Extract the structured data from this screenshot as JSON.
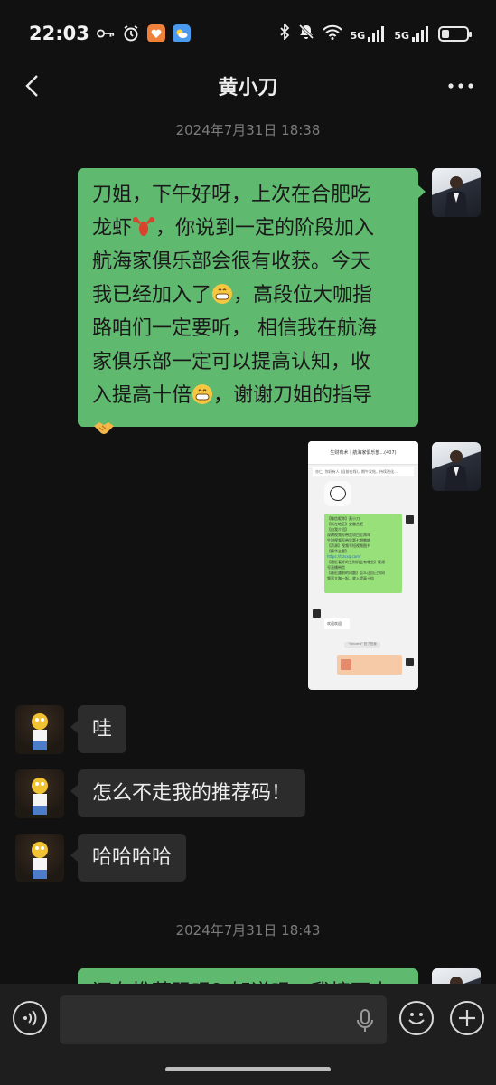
{
  "status_bar": {
    "time": "22:03",
    "network_1": "5G",
    "network_2": "5G",
    "icons": [
      "key-icon",
      "alarm-icon",
      "app-heart-icon",
      "app-weather-icon",
      "bluetooth-icon",
      "mute-icon",
      "wifi-icon",
      "signal-icon",
      "battery-icon"
    ],
    "battery_level": 0.3
  },
  "nav": {
    "title": "黄小刀",
    "back_icon": "chevron-left-icon",
    "more_icon": "more-dots-icon"
  },
  "messages": {
    "ts1": "2024年7月31日 18:38",
    "msg1": {
      "line1": "刀姐，下午好呀，上次在合肥吃",
      "line2a": "龙虾",
      "line2b": "，你说到一定的阶段加入",
      "line3": "航海家俱乐部会很有收获。今天",
      "line4a": "我已经加入了",
      "line4b": "，高段位大咖指",
      "line5": "路咱们一定要听， 相信我在航海",
      "line6": "家俱乐部一定可以提高认知，收",
      "line7a": "入提高十倍",
      "line7b": "，谢谢刀姐的指导"
    },
    "image": {
      "header": "生财有术｜航海家俱乐部...(407)",
      "notice": "亦仁: 你好有人 (当前在线)，期午发帖，持续进化...",
      "green_lines": [
        "【微信昵称】黄小刀",
        "【所在地区】安徽合肥",
        "【自我介绍】",
        "深耕视频号带货项目近两年",
        "生财视频号带货第七期教练",
        "【资源】视频号短视频图书",
        "【精华主题】",
        "https://t.zsxq.com/",
        "【最近看好的生财机会有哪些】视频",
        "号直播带货",
        "【最近遇到的问题】怎么让自己到同",
        "频率大咖一起，收入提高十倍"
      ],
      "reply": "欢迎欢迎",
      "system": "\"Vincent\" 拍了拍我"
    },
    "ts2": "2024年7月31日 18:43",
    "other": [
      {
        "text": "哇"
      },
      {
        "text": "怎么不走我的推荐码！"
      },
      {
        "text": "哈哈哈哈"
      }
    ],
    "msg_partial": "还有推荐码吗？知道吗，我接下来"
  },
  "input_bar": {
    "placeholder": "",
    "voice_icon": "voice-icon",
    "mic_icon": "mic-icon",
    "emoji_icon": "emoji-icon",
    "plus_icon": "plus-icon"
  }
}
